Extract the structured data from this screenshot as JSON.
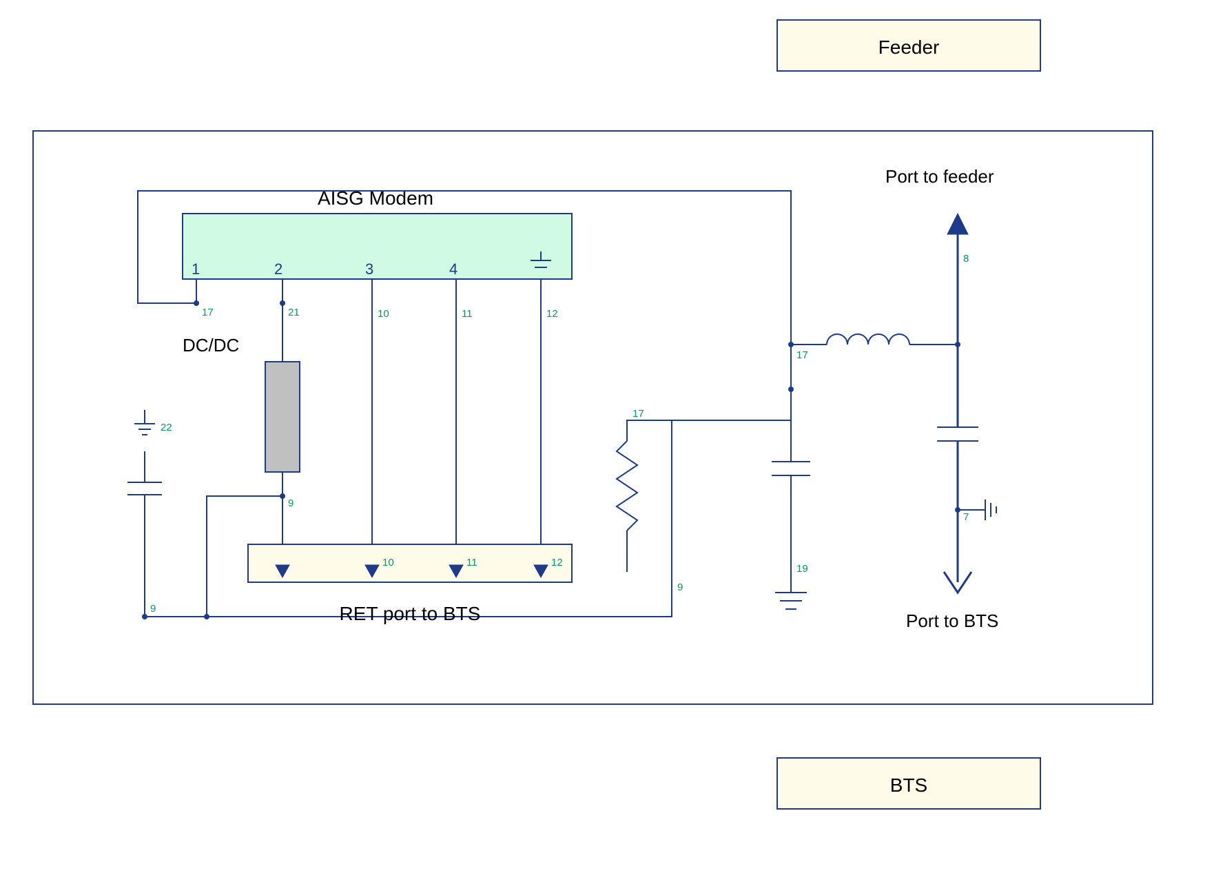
{
  "boxes": {
    "feeder_label": "Feeder",
    "bts_label": "BTS"
  },
  "blocks": {
    "modem_title": "AISG Modem",
    "modem_pins": {
      "p1": "1",
      "p2": "2",
      "p3": "3",
      "p4": "4"
    },
    "dcdc_label": "DC/DC",
    "ret_label": "RET port to BTS",
    "port_feeder": "Port to feeder",
    "port_bts": "Port to BTS"
  },
  "nets": {
    "n17a": "17",
    "n21": "21",
    "n10": "10",
    "n11": "11",
    "n12": "12",
    "n22": "22",
    "n9a": "9",
    "n9b": "9",
    "n9c": "9",
    "ret10": "10",
    "ret11": "11",
    "ret12": "12",
    "n17b": "17",
    "n17c": "17",
    "n19": "19",
    "n8": "8",
    "n7": "7"
  }
}
